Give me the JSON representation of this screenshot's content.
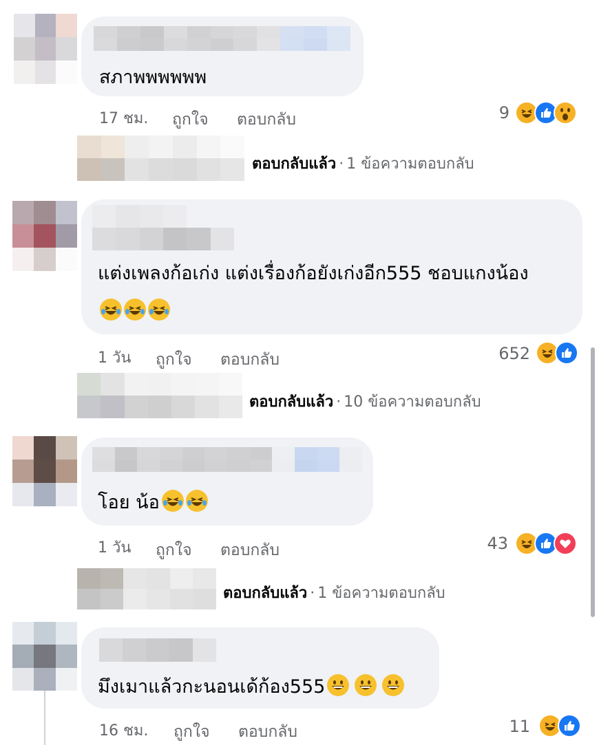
{
  "comments": [
    {
      "text": "สภาพพพพพพ",
      "time": "17 ชม.",
      "like_label": "ถูกใจ",
      "reply_label": "ตอบกลับ",
      "reaction_count": "9",
      "reactions": [
        "haha",
        "like",
        "wow"
      ],
      "reply_summary": {
        "replied": "ตอบกลับแล้ว",
        "sep": "·",
        "count": "1 ข้อความตอบกลับ"
      }
    },
    {
      "text_line1": "แต่งเพลงก้อเก่ง แต่งเรื่องก้อยังเก่งอีก555 ชอบแกงน้อง",
      "text_emojis": [
        "joy",
        "joy",
        "joy"
      ],
      "time": "1 วัน",
      "like_label": "ถูกใจ",
      "reply_label": "ตอบกลับ",
      "reaction_count": "652",
      "reactions": [
        "haha",
        "like"
      ],
      "reply_summary": {
        "replied": "ตอบกลับแล้ว",
        "sep": "·",
        "count": "10 ข้อความตอบกลับ"
      }
    },
    {
      "text": "โอย น้อ",
      "text_emojis": [
        "joy",
        "joy"
      ],
      "time": "1 วัน",
      "like_label": "ถูกใจ",
      "reply_label": "ตอบกลับ",
      "reaction_count": "43",
      "reactions": [
        "haha",
        "like",
        "love"
      ],
      "reply_summary": {
        "replied": "ตอบกลับแล้ว",
        "sep": "·",
        "count": "1 ข้อความตอบกลับ"
      }
    },
    {
      "text": "มึงเมาแล้วกะนอนเด้ก้อง555",
      "text_emojis": [
        "grin",
        "grin",
        "grin"
      ],
      "time": "16 ชม.",
      "like_label": "ถูกใจ",
      "reply_label": "ตอบกลับ",
      "reaction_count": "11",
      "reactions": [
        "haha",
        "like"
      ]
    }
  ],
  "colors": {
    "bubble": "#f0f2f5",
    "meta": "#65676b",
    "like_blue": "#1877f2",
    "haha_yellow": "#f7b125",
    "love_red": "#f33e58"
  }
}
